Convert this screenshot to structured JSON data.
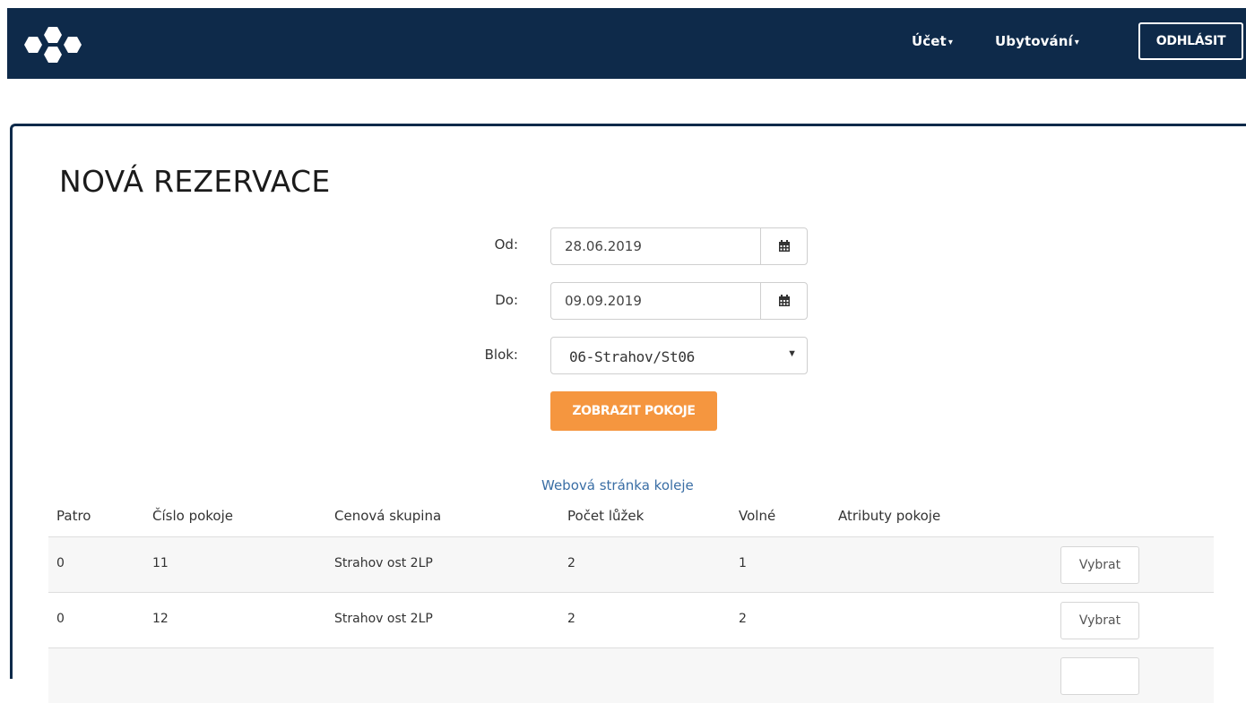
{
  "nav": {
    "account": "Účet",
    "accommodation": "Ubytování",
    "logout": "ODHLÁSIT"
  },
  "page_title": "NOVÁ REZERVACE",
  "form": {
    "from_label": "Od:",
    "from_value": "28.06.2019",
    "to_label": "Do:",
    "to_value": "09.09.2019",
    "block_label": "Blok:",
    "block_value": "06-Strahov/St06",
    "submit": "ZOBRAZIT POKOJE"
  },
  "web_link": "Webová stránka koleje",
  "table": {
    "headers": [
      "Patro",
      "Číslo pokoje",
      "Cenová skupina",
      "Počet lůžek",
      "Volné",
      "Atributy pokoje"
    ],
    "rows": [
      {
        "floor": "0",
        "room": "11",
        "group": "Strahov ost 2LP",
        "beds": "2",
        "free": "1",
        "attrs": "",
        "action": "Vybrat"
      },
      {
        "floor": "0",
        "room": "12",
        "group": "Strahov ost 2LP",
        "beds": "2",
        "free": "2",
        "attrs": "",
        "action": "Vybrat"
      },
      {
        "floor": "",
        "room": "",
        "group": "",
        "beds": "",
        "free": "",
        "attrs": "",
        "action": ""
      }
    ]
  },
  "colors": {
    "navbar": "#0e2a4a",
    "accent": "#f5963f",
    "link": "#3a6ea5"
  },
  "icons": [
    "logo-icon",
    "caret-down-icon",
    "calendar-icon",
    "select-arrow-icon"
  ]
}
